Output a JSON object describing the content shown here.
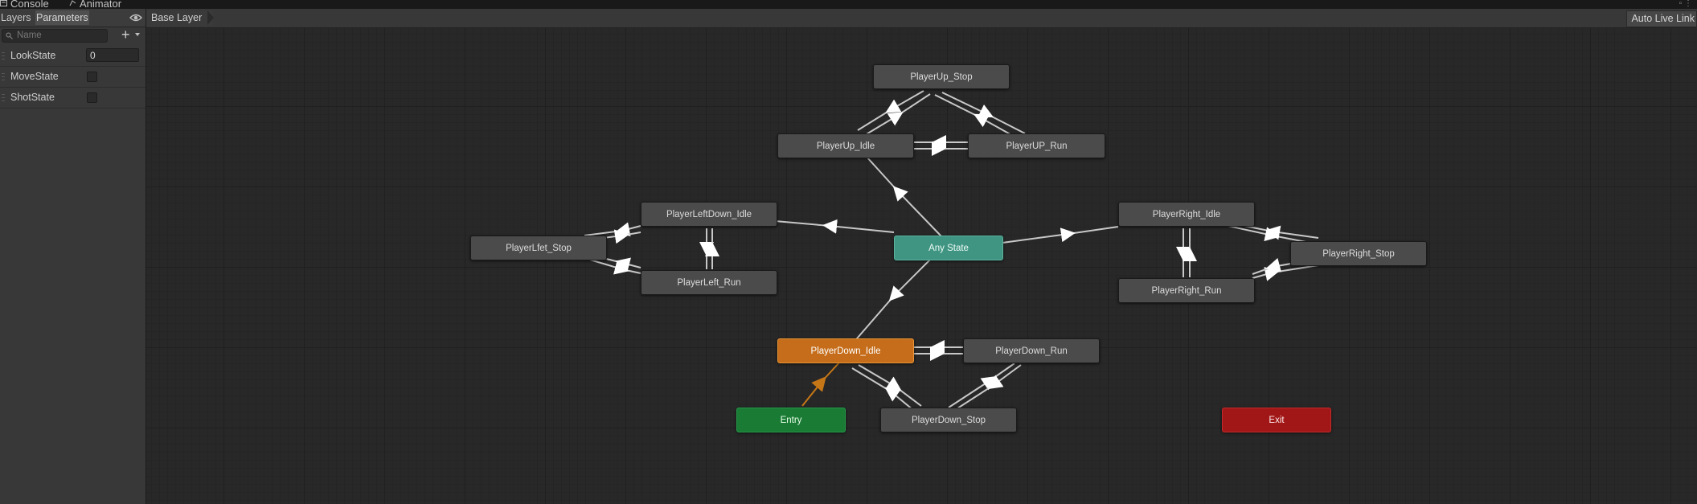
{
  "tabs": [
    {
      "label": "Console",
      "icon": "console-icon"
    },
    {
      "label": "Animator",
      "icon": "animator-icon"
    }
  ],
  "left_panel": {
    "subtabs": [
      "Layers",
      "Parameters"
    ],
    "active_subtab": "Parameters",
    "search_placeholder": "Name",
    "add_label": "+",
    "parameters": [
      {
        "name": "LookState",
        "type": "int",
        "value": "0"
      },
      {
        "name": "MoveState",
        "type": "bool",
        "checked": false
      },
      {
        "name": "ShotState",
        "type": "bool",
        "checked": false
      }
    ]
  },
  "graph": {
    "breadcrumb": "Base Layer",
    "auto_live_link": "Auto Live Link",
    "states": {
      "up_stop": "PlayerUp_Stop",
      "up_idle": "PlayerUp_Idle",
      "up_run": "PlayerUP_Run",
      "leftdown_idle": "PlayerLeftDown_Idle",
      "left_stop": "PlayerLfet_Stop",
      "left_run": "PlayerLeft_Run",
      "any_state": "Any State",
      "right_idle": "PlayerRight_Idle",
      "right_stop": "PlayerRight_Stop",
      "right_run": "PlayerRight_Run",
      "down_idle": "PlayerDown_Idle",
      "down_run": "PlayerDown_Run",
      "entry": "Entry",
      "down_stop": "PlayerDown_Stop",
      "exit": "Exit"
    },
    "default_state": "PlayerDown_Idle",
    "colors": {
      "state": "#4b4b4b",
      "default_state": "#c56d1a",
      "entry": "#1a7b35",
      "exit": "#a11717",
      "any_state": "#3f9582",
      "transition": "#c8c8c8",
      "entry_transition": "#c57717"
    }
  }
}
